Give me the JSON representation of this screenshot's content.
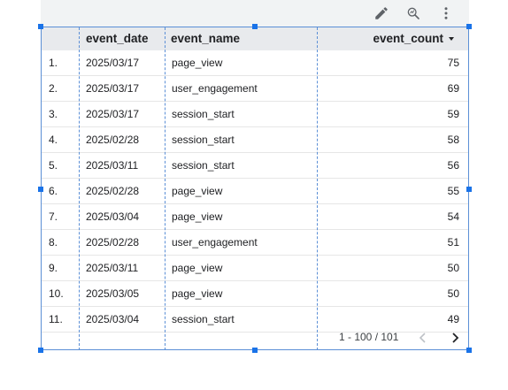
{
  "toolbar": {
    "icons": [
      "pencil-icon",
      "explore-icon",
      "more-vert-icon"
    ]
  },
  "table": {
    "columns": [
      "event_date",
      "event_name",
      "event_count"
    ],
    "sort_column": "event_count",
    "sort_direction": "descending",
    "rows": [
      {
        "idx": "1.",
        "date": "2025/03/17",
        "name": "page_view",
        "count": "75"
      },
      {
        "idx": "2.",
        "date": "2025/03/17",
        "name": "user_engagement",
        "count": "69"
      },
      {
        "idx": "3.",
        "date": "2025/03/17",
        "name": "session_start",
        "count": "59"
      },
      {
        "idx": "4.",
        "date": "2025/02/28",
        "name": "session_start",
        "count": "58"
      },
      {
        "idx": "5.",
        "date": "2025/03/11",
        "name": "session_start",
        "count": "56"
      },
      {
        "idx": "6.",
        "date": "2025/02/28",
        "name": "page_view",
        "count": "55"
      },
      {
        "idx": "7.",
        "date": "2025/03/04",
        "name": "page_view",
        "count": "54"
      },
      {
        "idx": "8.",
        "date": "2025/02/28",
        "name": "user_engagement",
        "count": "51"
      },
      {
        "idx": "9.",
        "date": "2025/03/11",
        "name": "page_view",
        "count": "50"
      },
      {
        "idx": "10.",
        "date": "2025/03/05",
        "name": "page_view",
        "count": "50"
      },
      {
        "idx": "11.",
        "date": "2025/03/04",
        "name": "session_start",
        "count": "49"
      }
    ]
  },
  "pagination": {
    "label": "1 - 100 / 101"
  },
  "colors": {
    "selection": "#1a73e8",
    "header_bg": "#e8eaed",
    "toolbar_bg": "#f1f3f4"
  }
}
